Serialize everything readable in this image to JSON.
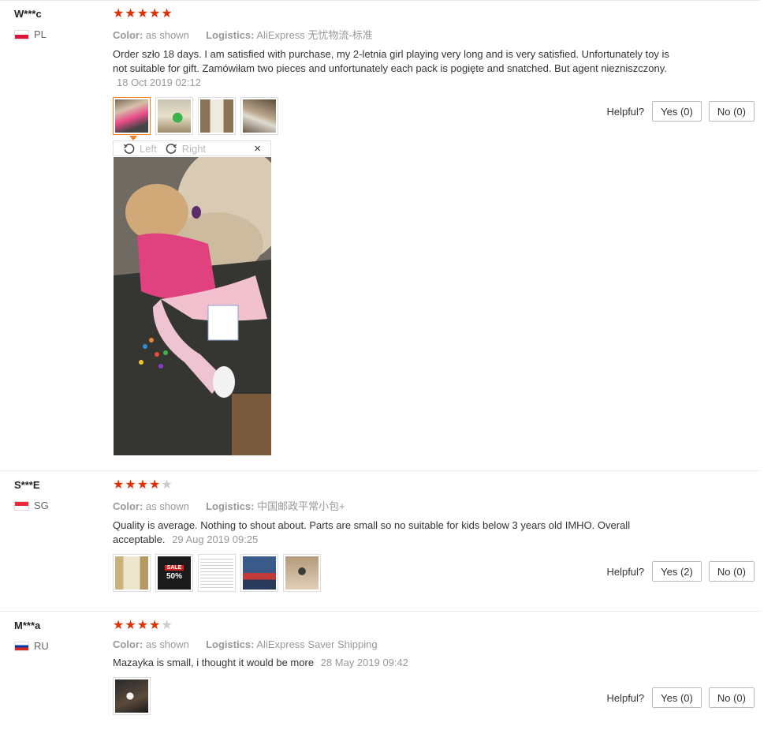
{
  "labels": {
    "color": "Color:",
    "logistics": "Logistics:",
    "helpful": "Helpful?"
  },
  "reviews": [
    {
      "buyer": "W***c",
      "country": "PL",
      "rating": 5,
      "color": "as shown",
      "logistics": "AliExpress 无忧物流-标准",
      "text": "Order szło 18 days. I am satisfied with purchase, my 2-letnia girl playing very long and is very satisfied. Unfortunately toy is not suitable for gift. Zamówiłam two pieces and unfortunately each pack is pogięte and snatched. But agent niezniszczony.",
      "date": "18 Oct 2019 02:12",
      "yes": "Yes (0)",
      "no": "No (0)",
      "thumbnail_count": 4
    },
    {
      "buyer": "S***E",
      "country": "SG",
      "rating": 4,
      "color": "as shown",
      "logistics": "中国邮政平常小包+",
      "text": "Quality is average. Nothing to shout about. Parts are small so no suitable for kids below 3 years old IMHO. Overall acceptable.",
      "date": "29 Aug 2019 09:25",
      "yes": "Yes (2)",
      "no": "No (0)",
      "thumbnail_count": 5,
      "thumb_sale_text": "SALE",
      "thumb_sale_percent": "50%"
    },
    {
      "buyer": "M***a",
      "country": "RU",
      "rating": 4,
      "color": "as shown",
      "logistics": "AliExpress Saver Shipping",
      "text": "Mazayka is small, i thought it would be more",
      "date": "28 May 2019 09:42",
      "yes": "Yes (0)",
      "no": "No (0)",
      "thumbnail_count": 1
    }
  ],
  "viewer": {
    "rotate_left": "Left",
    "rotate_right": "Right",
    "close": "×"
  },
  "colors": {
    "star_on": "#e62e04",
    "star_off": "#cccccc",
    "active_thumb": "#f08020"
  }
}
